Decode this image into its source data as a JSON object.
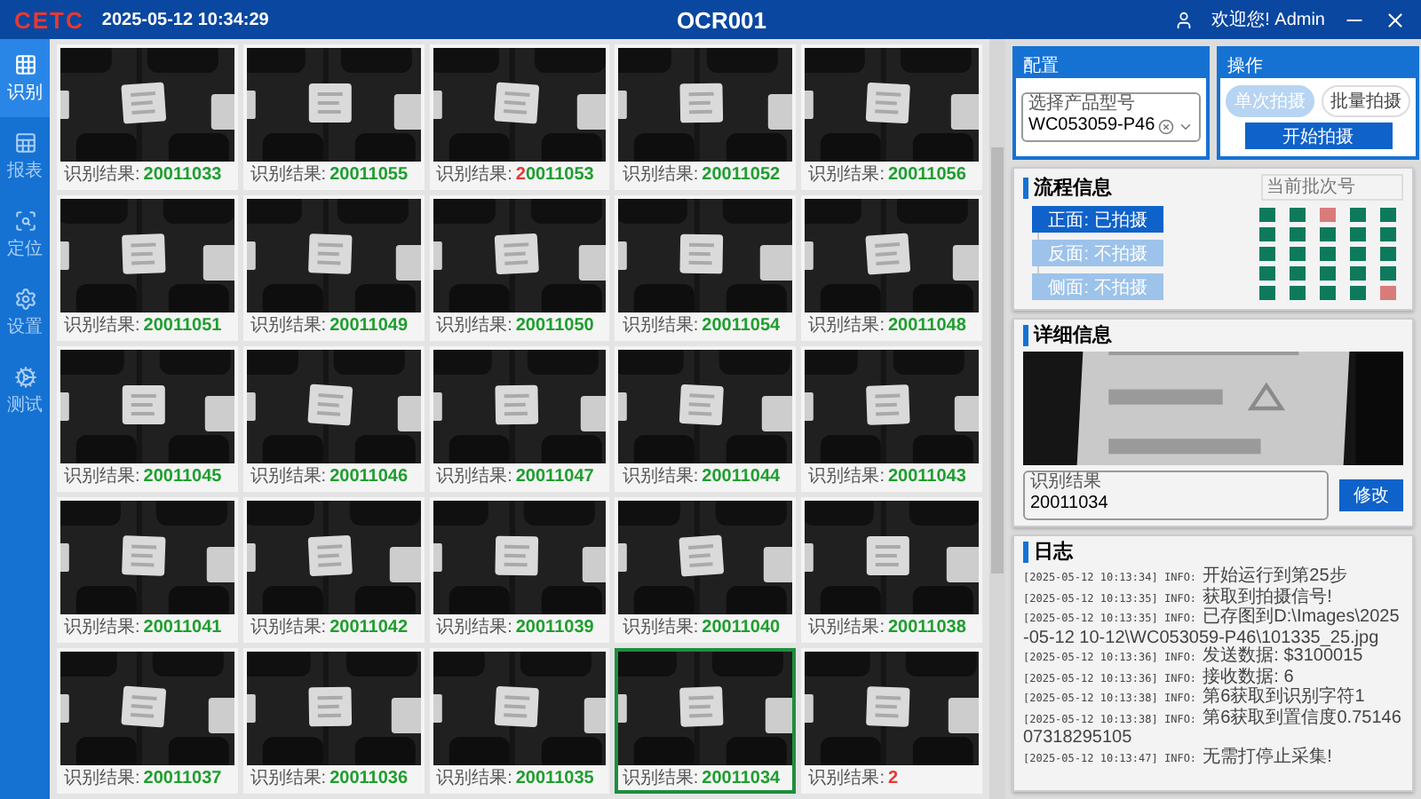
{
  "header": {
    "logo": "CETC",
    "datetime": "2025-05-12 10:34:29",
    "title": "OCR001",
    "user": "欢迎您! Admin"
  },
  "sidebar": [
    {
      "label": "识别",
      "selected": true
    },
    {
      "label": "报表",
      "selected": false
    },
    {
      "label": "定位",
      "selected": false
    },
    {
      "label": "设置",
      "selected": false
    },
    {
      "label": "测试",
      "selected": false
    }
  ],
  "cards": [
    {
      "label": "识别结果:",
      "selected": false,
      "result": [
        {
          "text": "20011033",
          "ok": true
        }
      ]
    },
    {
      "label": "识别结果:",
      "selected": false,
      "result": [
        {
          "text": "20011055",
          "ok": true
        }
      ]
    },
    {
      "label": "识别结果:",
      "selected": false,
      "result": [
        {
          "text": "2",
          "ok": false
        },
        {
          "text": "0011053",
          "ok": true
        }
      ]
    },
    {
      "label": "识别结果:",
      "selected": false,
      "result": [
        {
          "text": "20011052",
          "ok": true
        }
      ]
    },
    {
      "label": "识别结果:",
      "selected": false,
      "result": [
        {
          "text": "20011056",
          "ok": true
        }
      ]
    },
    {
      "label": "识别结果:",
      "selected": false,
      "result": [
        {
          "text": "20011051",
          "ok": true
        }
      ]
    },
    {
      "label": "识别结果:",
      "selected": false,
      "result": [
        {
          "text": "20011049",
          "ok": true
        }
      ]
    },
    {
      "label": "识别结果:",
      "selected": false,
      "result": [
        {
          "text": "20011050",
          "ok": true
        }
      ]
    },
    {
      "label": "识别结果:",
      "selected": false,
      "result": [
        {
          "text": "20011054",
          "ok": true
        }
      ]
    },
    {
      "label": "识别结果:",
      "selected": false,
      "result": [
        {
          "text": "20011048",
          "ok": true
        }
      ]
    },
    {
      "label": "识别结果:",
      "selected": false,
      "result": [
        {
          "text": "20011045",
          "ok": true
        }
      ]
    },
    {
      "label": "识别结果:",
      "selected": false,
      "result": [
        {
          "text": "20011046",
          "ok": true
        }
      ]
    },
    {
      "label": "识别结果:",
      "selected": false,
      "result": [
        {
          "text": "20011047",
          "ok": true
        }
      ]
    },
    {
      "label": "识别结果:",
      "selected": false,
      "result": [
        {
          "text": "20011044",
          "ok": true
        }
      ]
    },
    {
      "label": "识别结果:",
      "selected": false,
      "result": [
        {
          "text": "20011043",
          "ok": true
        }
      ]
    },
    {
      "label": "识别结果:",
      "selected": false,
      "result": [
        {
          "text": "20011041",
          "ok": true
        }
      ]
    },
    {
      "label": "识别结果:",
      "selected": false,
      "result": [
        {
          "text": "20011042",
          "ok": true
        }
      ]
    },
    {
      "label": "识别结果:",
      "selected": false,
      "result": [
        {
          "text": "20011039",
          "ok": true
        }
      ]
    },
    {
      "label": "识别结果:",
      "selected": false,
      "result": [
        {
          "text": "20011040",
          "ok": true
        }
      ]
    },
    {
      "label": "识别结果:",
      "selected": false,
      "result": [
        {
          "text": "20011038",
          "ok": true
        }
      ]
    },
    {
      "label": "识别结果:",
      "selected": false,
      "result": [
        {
          "text": "20011037",
          "ok": true
        }
      ]
    },
    {
      "label": "识别结果:",
      "selected": false,
      "result": [
        {
          "text": "20011036",
          "ok": true
        }
      ]
    },
    {
      "label": "识别结果:",
      "selected": false,
      "result": [
        {
          "text": "20011035",
          "ok": true
        }
      ]
    },
    {
      "label": "识别结果:",
      "selected": true,
      "result": [
        {
          "text": "20011034",
          "ok": true
        }
      ]
    },
    {
      "label": "识别结果:",
      "selected": false,
      "result": [
        {
          "text": "2",
          "ok": false
        }
      ]
    }
  ],
  "config": {
    "title": "配置",
    "model_field": {
      "label": "选择产品型号",
      "value": "WC053059-P46"
    }
  },
  "operation": {
    "title": "操作",
    "modes": [
      {
        "label": "单次拍摄",
        "selected": true
      },
      {
        "label": "批量拍摄",
        "selected": false
      }
    ],
    "start_button": "开始拍摄"
  },
  "flow": {
    "title": "流程信息",
    "batch_field": {
      "placeholder": "当前批次号"
    },
    "steps": [
      {
        "label": "正面: 已拍摄",
        "done": true
      },
      {
        "label": "反面: 不拍摄",
        "done": false
      },
      {
        "label": "侧面: 不拍摄",
        "done": false
      }
    ],
    "slots": [
      {
        "color": "#0e7a5c"
      },
      {
        "color": "#0e7a5c"
      },
      {
        "color": "#d97b7b"
      },
      {
        "color": "#0e7a5c"
      },
      {
        "color": "#0e7a5c"
      },
      {
        "color": "#0e7a5c"
      },
      {
        "color": "#0e7a5c"
      },
      {
        "color": "#0e7a5c"
      },
      {
        "color": "#0e7a5c"
      },
      {
        "color": "#0e7a5c"
      },
      {
        "color": "#0e7a5c"
      },
      {
        "color": "#0e7a5c"
      },
      {
        "color": "#0e7a5c"
      },
      {
        "color": "#0e7a5c"
      },
      {
        "color": "#0e7a5c"
      },
      {
        "color": "#0e7a5c"
      },
      {
        "color": "#0e7a5c"
      },
      {
        "color": "#0e7a5c"
      },
      {
        "color": "#0e7a5c"
      },
      {
        "color": "#0e7a5c"
      },
      {
        "color": "#0e7a5c"
      },
      {
        "color": "#0e7a5c"
      },
      {
        "color": "#0e7a5c"
      },
      {
        "color": "#0e7a5c"
      },
      {
        "color": "#d97b7b"
      }
    ]
  },
  "detail": {
    "title": "详细信息",
    "result_field": {
      "label": "识别结果",
      "value": "20011034"
    },
    "edit_button": "修改"
  },
  "log": {
    "title": "日志",
    "lines": [
      {
        "time": "[2025-05-12 10:13:34]",
        "level": "INFO:",
        "message": "开始运行到第25步"
      },
      {
        "time": "[2025-05-12 10:13:35]",
        "level": "INFO:",
        "message": "获取到拍摄信号!"
      },
      {
        "time": "[2025-05-12 10:13:35]",
        "level": "INFO:",
        "message": "已存图到D:\\Images\\2025-05-12 10-12\\WC053059-P46\\101335_25.jpg"
      },
      {
        "time": "[2025-05-12 10:13:36]",
        "level": "INFO:",
        "message": "发送数据: $3100015"
      },
      {
        "time": "[2025-05-12 10:13:36]",
        "level": "INFO:",
        "message": "接收数据: 6"
      },
      {
        "time": "[2025-05-12 10:13:38]",
        "level": "INFO:",
        "message": "第6获取到识别字符1"
      },
      {
        "time": "[2025-05-12 10:13:38]",
        "level": "INFO:",
        "message": "第6获取到置信度0.7514607318295105"
      },
      {
        "time": "[2025-05-12 10:13:47]",
        "level": "INFO:",
        "message": "无需打停止采集!"
      }
    ]
  }
}
